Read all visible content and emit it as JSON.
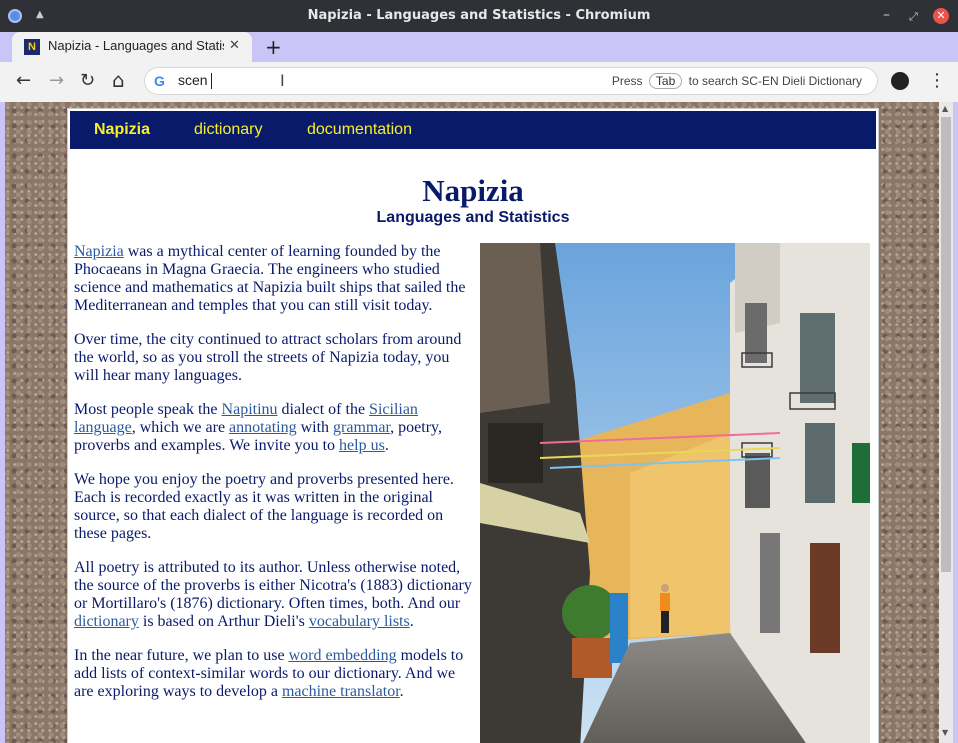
{
  "window": {
    "title": "Napizia - Languages and Statistics - Chromium"
  },
  "tab": {
    "favicon_letter": "N",
    "title": "Napizia - Languages and Statistics",
    "close": "✕",
    "new_tab": "+"
  },
  "toolbar": {
    "back": "←",
    "forward": "→",
    "reload": "↻",
    "home": "⌂",
    "omnibox_value": "scen",
    "hint_press": "Press",
    "hint_key": "Tab",
    "hint_rest": "to search SC-EN Dieli Dictionary",
    "menu": "⋮"
  },
  "site": {
    "nav": {
      "brand": "Napizia",
      "dictionary": "dictionary",
      "documentation": "documentation"
    },
    "title": "Napizia",
    "subtitle": "Languages and Statistics",
    "paragraphs": {
      "p1": {
        "link1": "Napizia",
        "text1": " was a mythical center of learning founded by the Phocaeans in Magna Graecia. The engineers who studied science and mathematics at Napizia built ships that sailed the Mediterranean and temples that you can still visit today."
      },
      "p2": {
        "text1": "Over time, the city continued to attract scholars from around the world, so as you stroll the streets of Napizia today, you will hear many languages."
      },
      "p3": {
        "text1": "Most people speak the ",
        "link1": "Napitinu",
        "text2": " dialect of the ",
        "link2": "Sicilian language",
        "text3": ", which we are ",
        "link3": "annotating",
        "text4": " with ",
        "link4": "grammar",
        "text5": ", poetry, proverbs and examples. We invite you to ",
        "link5": "help us",
        "text6": "."
      },
      "p4": {
        "text1": "We hope you enjoy the poetry and proverbs presented here. Each is recorded exactly as it was written in the original source, so that each dialect of the language is recorded on these pages."
      },
      "p5": {
        "text1": "All poetry is attributed to its author. Unless otherwise noted, the source of the proverbs is either Nicotra's (1883) dictionary or Mortillaro's (1876) dictionary. Often times, both. And our ",
        "link1": "dictionary",
        "text2": " is based on Arthur Dieli's ",
        "link2": "vocabulary lists",
        "text3": "."
      },
      "p6": {
        "text1": "In the near future, we plan to use ",
        "link1": "word embedding",
        "text2": " models to add lists of context-similar words to our dictionary. And we are exploring ways to develop a ",
        "link2": "machine translator",
        "text3": "."
      }
    }
  },
  "colors": {
    "navbar": "#0a1a6b",
    "nav_text": "#f5f02a",
    "link": "#2a5a9e",
    "tabstrip": "#c9c6f7"
  }
}
